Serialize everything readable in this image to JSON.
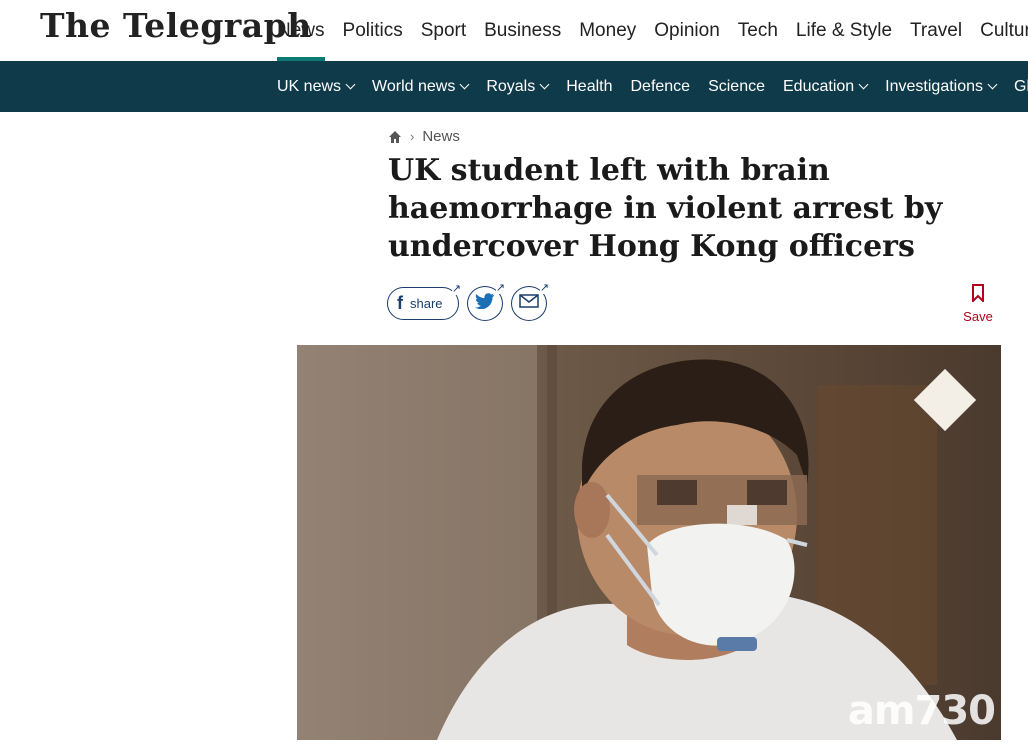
{
  "header": {
    "logo": "The Telegraph",
    "nav": [
      "News",
      "Politics",
      "Sport",
      "Business",
      "Money",
      "Opinion",
      "Tech",
      "Life & Style",
      "Travel",
      "Culture"
    ],
    "active_nav": "News"
  },
  "subnav": {
    "items": [
      {
        "label": "UK news",
        "dropdown": true
      },
      {
        "label": "World news",
        "dropdown": true
      },
      {
        "label": "Royals",
        "dropdown": true
      },
      {
        "label": "Health",
        "dropdown": false
      },
      {
        "label": "Defence",
        "dropdown": false
      },
      {
        "label": "Science",
        "dropdown": false
      },
      {
        "label": "Education",
        "dropdown": true
      },
      {
        "label": "Investigations",
        "dropdown": true
      },
      {
        "label": "Gl",
        "dropdown": false
      }
    ]
  },
  "breadcrumb": {
    "home_icon": "home-icon",
    "section": "News"
  },
  "article": {
    "headline": "UK student left with brain haemorrhage in violent arrest by undercover Hong Kong officers"
  },
  "share": {
    "facebook_label": "share",
    "save_label": "Save"
  },
  "image": {
    "watermark": "am730"
  },
  "colors": {
    "subnav_bg": "#0f3a4a",
    "accent": "#0b7a75",
    "save_red": "#b3001b",
    "share_blue": "#1a3d6b"
  }
}
